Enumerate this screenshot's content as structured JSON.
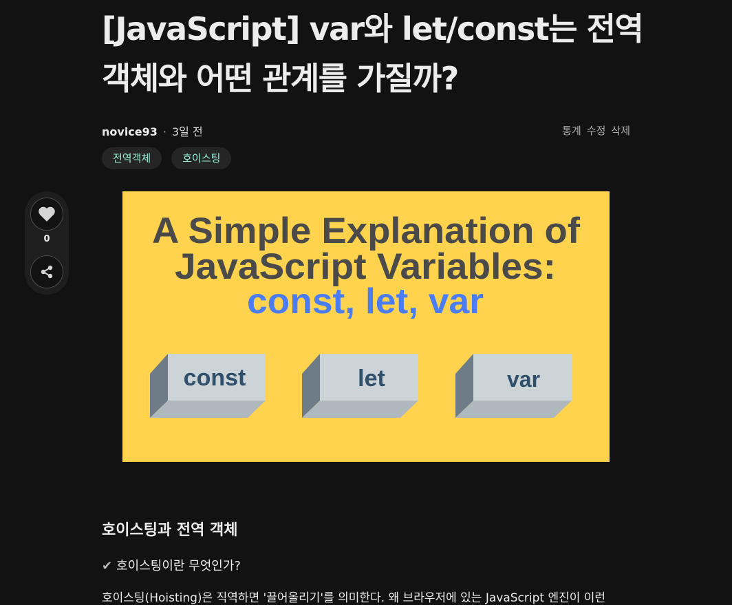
{
  "post": {
    "title": "[JavaScript] var와 let/const는 전역 객체와 어떤 관계를 가질까?",
    "author": "novice93",
    "separator": "·",
    "date": "3일 전",
    "actions": [
      "통계",
      "수정",
      "삭제"
    ],
    "tags": [
      "전역객체",
      "호이스팅"
    ]
  },
  "sidebar": {
    "like_count": "0",
    "icons": {
      "like": "heart-icon",
      "share": "share-icon"
    }
  },
  "thumbnail": {
    "line1": "A Simple Explanation of",
    "line2": "JavaScript Variables:",
    "line3": "const, let, var",
    "blocks": [
      "const",
      "let",
      "var"
    ],
    "colors": {
      "background": "#ffd34e",
      "heading": "#4a4a4a",
      "accent": "#4a7cf5",
      "block_label": "#2f4f6b"
    }
  },
  "content": {
    "heading": "호이스팅과 전역 객체",
    "subheading": "호이스팅이란 무엇인가?",
    "check_icon": "checkmark-icon",
    "body_line": "호이스팅(Hoisting)은 직역하면 '끌어올리기'를 의미한다. 왜 브라우저에 있는 JavaScript 엔진이 이런"
  }
}
